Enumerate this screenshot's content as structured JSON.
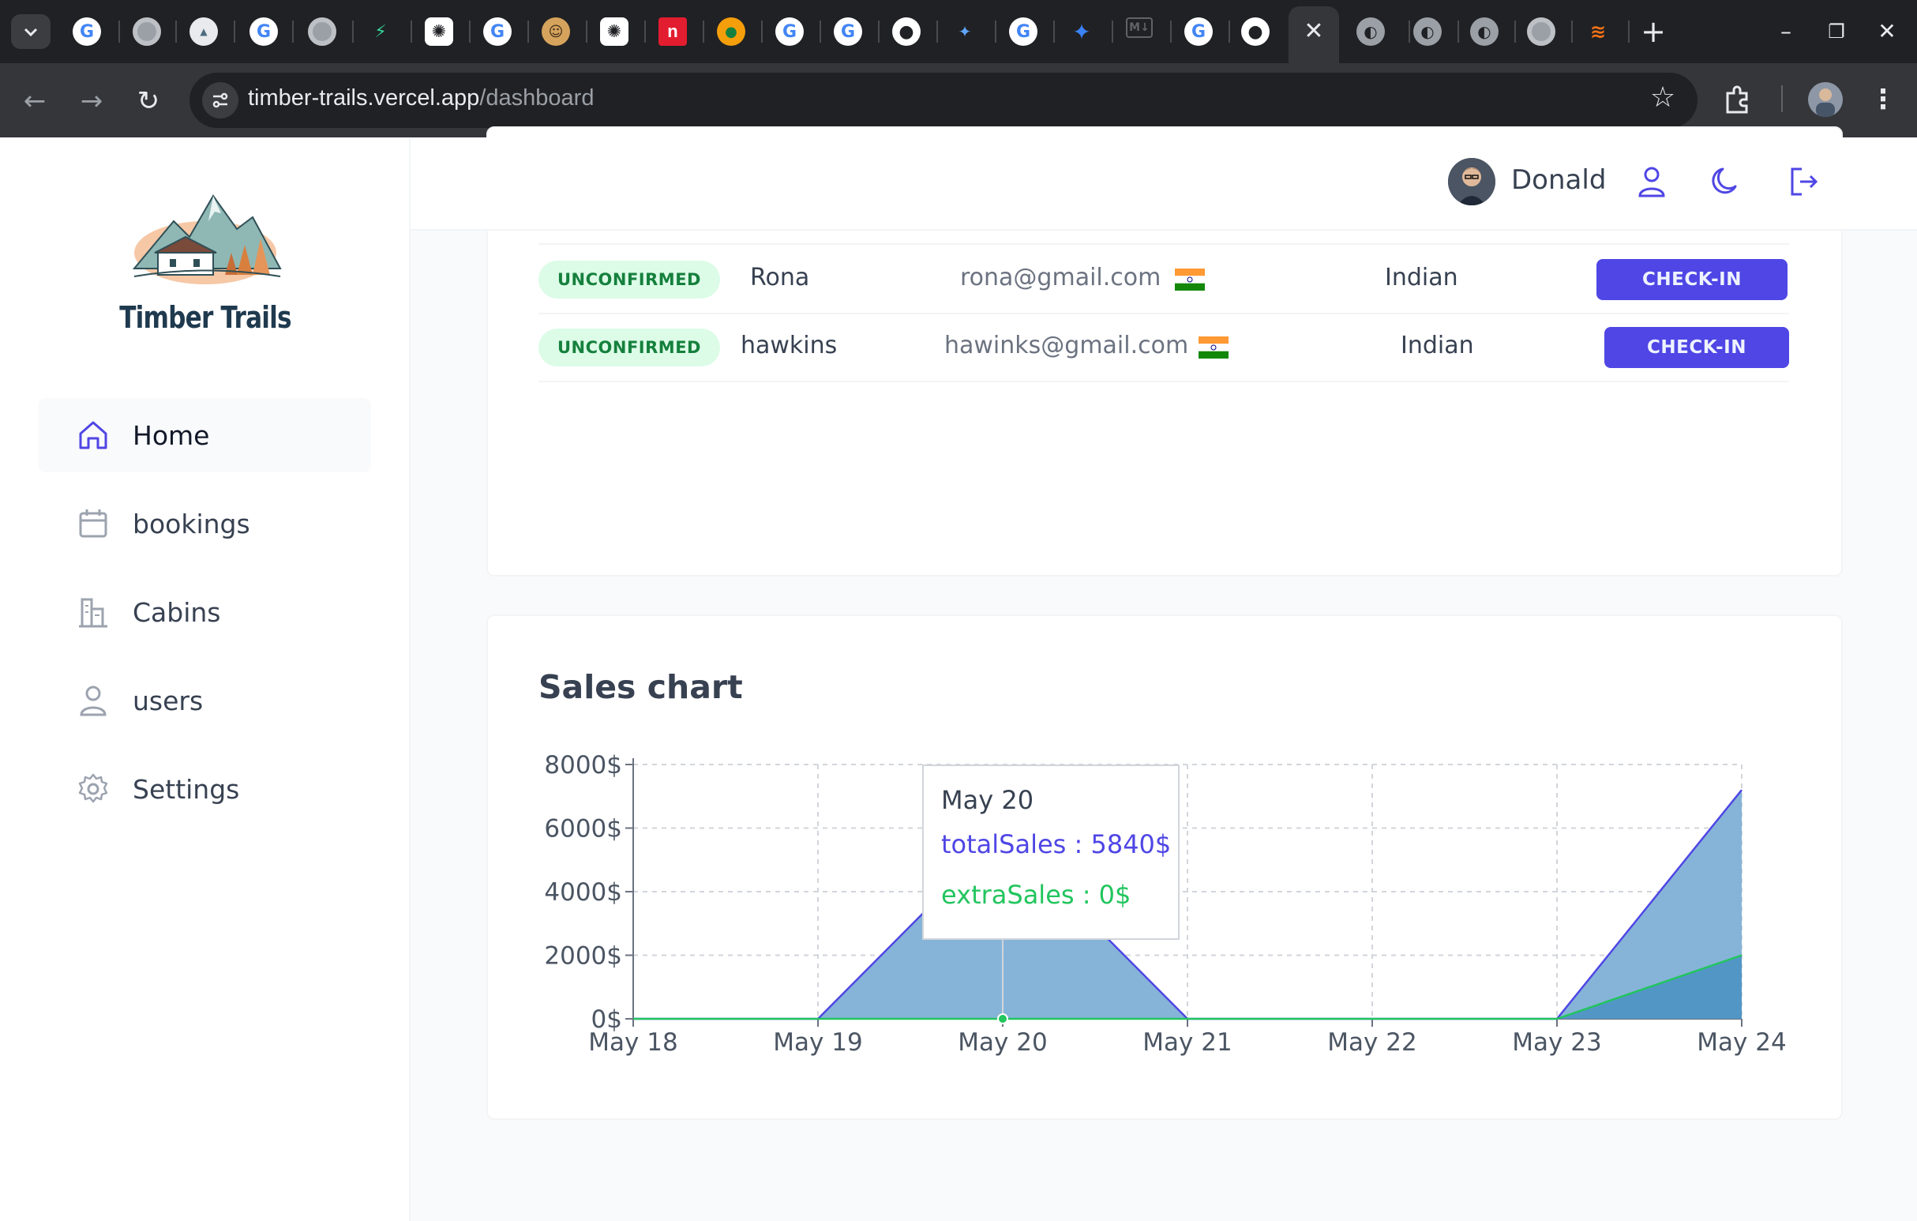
{
  "browser": {
    "url_host": "timber-trails.vercel.app",
    "url_path": "/dashboard",
    "tab_close": "✕",
    "new_tab": "+"
  },
  "app": {
    "brand": "Timber Trails",
    "nav": [
      {
        "label": "Home"
      },
      {
        "label": "bookings"
      },
      {
        "label": "Cabins"
      },
      {
        "label": "users"
      },
      {
        "label": "Settings"
      }
    ],
    "user_name": "Donald"
  },
  "bookings": [
    {
      "status": "UNCONFIRMED",
      "name": "Rona",
      "email": "rona@gmail.com",
      "nationality": "Indian",
      "action": "CHECK-IN"
    },
    {
      "status": "UNCONFIRMED",
      "name": "hawkins",
      "email": "hawinks@gmail.com",
      "nationality": "Indian",
      "action": "CHECK-IN"
    }
  ],
  "sales": {
    "title": "Sales chart",
    "tooltip": {
      "date": "May 20",
      "total_line": "totalSales : 5840$",
      "extra_line": "extraSales : 0$"
    }
  },
  "colors": {
    "accent": "#4f46e5",
    "total_fill": "#7fb0d6",
    "extra_fill": "#4f95c5",
    "extra_line": "#22c55e",
    "badge_bg": "#dcfce7",
    "badge_text": "#15803d"
  },
  "chart_data": {
    "type": "area",
    "title": "Sales chart",
    "categories": [
      "May 18",
      "May 19",
      "May 20",
      "May 21",
      "May 22",
      "May 23",
      "May 24"
    ],
    "y_tick_labels": [
      "0$",
      "2000$",
      "4000$",
      "6000$",
      "8000$"
    ],
    "ylim": [
      0,
      8000
    ],
    "grid": true,
    "series": [
      {
        "name": "totalSales",
        "values": [
          0,
          0,
          5840,
          0,
          0,
          0,
          7200
        ]
      },
      {
        "name": "extraSales",
        "values": [
          0,
          0,
          0,
          0,
          0,
          0,
          2000
        ]
      }
    ]
  }
}
